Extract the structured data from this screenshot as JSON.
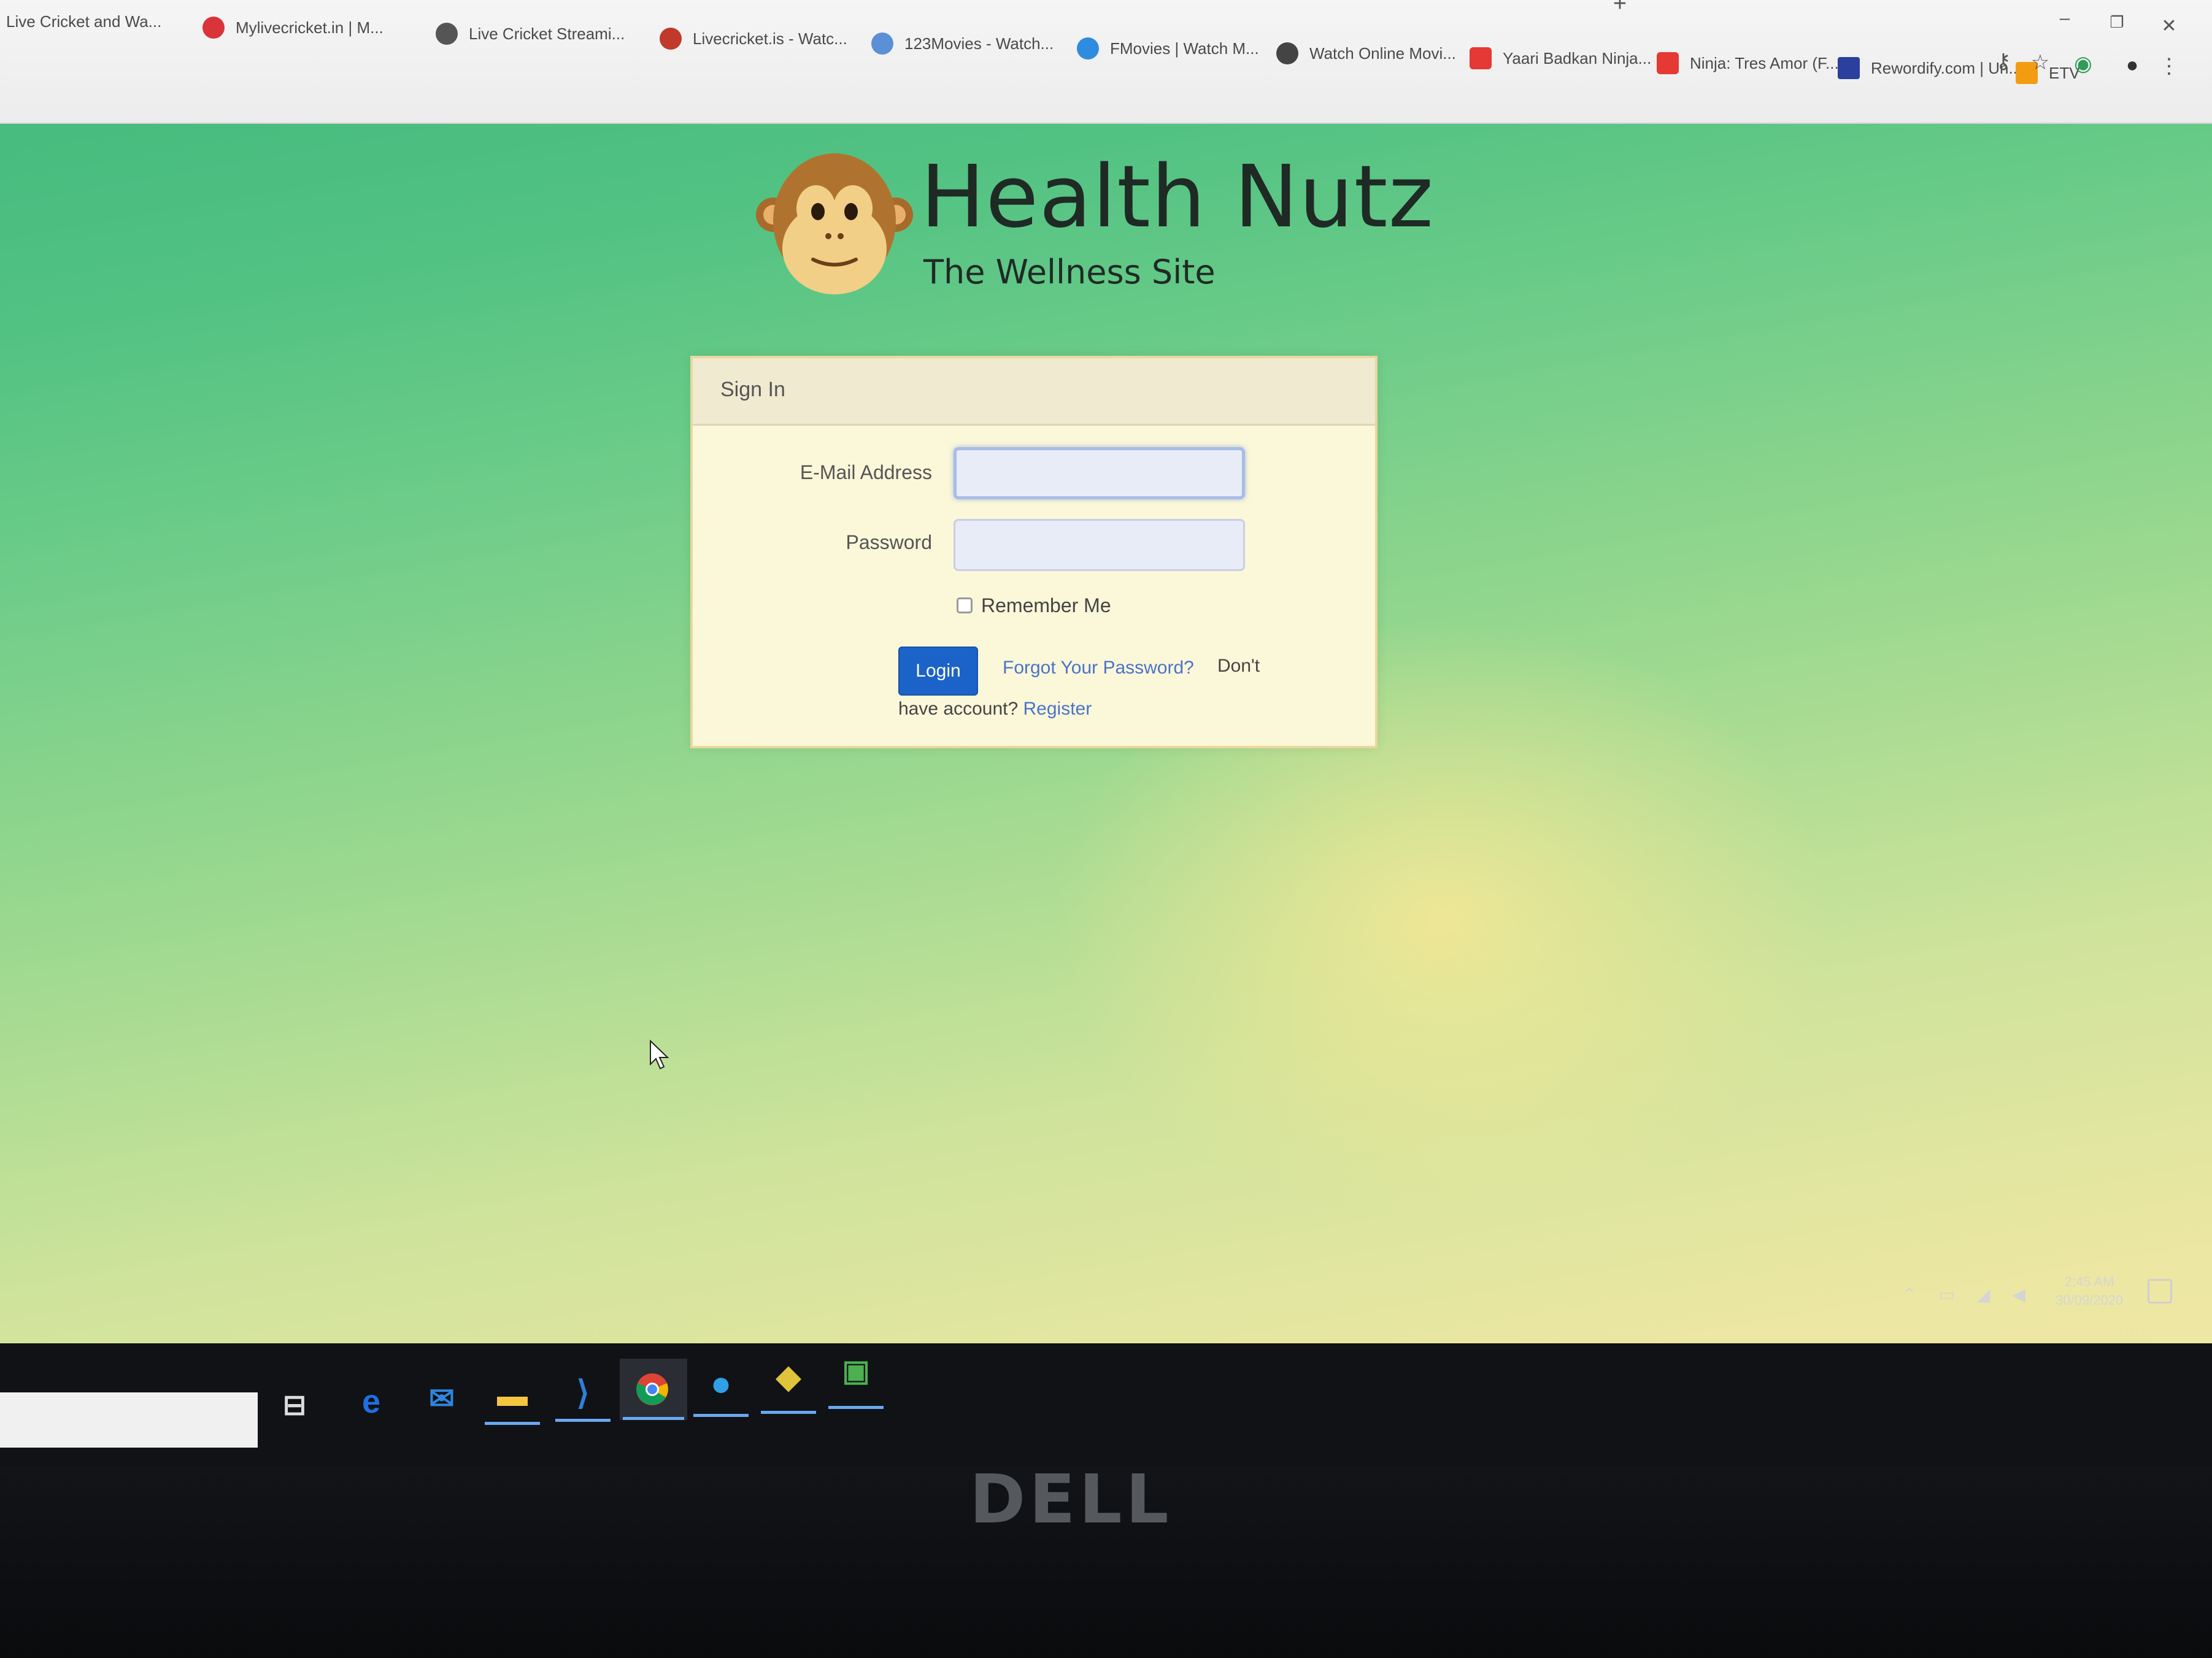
{
  "bookmarks": [
    {
      "label": "Live Cricket and Wa...",
      "color": "#8a8a8a"
    },
    {
      "label": "Mylivecricket.in | M...",
      "color": "#d9343a"
    },
    {
      "label": "Live Cricket Streami...",
      "color": "#555555"
    },
    {
      "label": "Livecricket.is - Watc...",
      "color": "#c0392b"
    },
    {
      "label": "123Movies - Watch...",
      "color": "#5b8fd6"
    },
    {
      "label": "FMovies | Watch M...",
      "color": "#2f8be0"
    },
    {
      "label": "Watch Online Movi...",
      "color": "#444444"
    },
    {
      "label": "Yaari Badkan Ninja...",
      "color": "#e53935"
    },
    {
      "label": "Ninja: Tres Amor (F...",
      "color": "#e53935"
    },
    {
      "label": "Rewordify.com | Un...",
      "color": "#2a3f9e"
    },
    {
      "label": "ETV",
      "color": "#f39c12"
    }
  ],
  "site": {
    "title": "Health Nutz",
    "subtitle": "The Wellness Site"
  },
  "signin": {
    "header": "Sign In",
    "email_label": "E-Mail Address",
    "email_value": "",
    "password_label": "Password",
    "password_value": "",
    "remember_label": "Remember Me",
    "remember_checked": false,
    "login_label": "Login",
    "forgot_label": "Forgot Your Password?",
    "dont_text": "Don't",
    "have_account_text": "have account?",
    "register_label": "Register"
  },
  "clock": {
    "time": "2:45 AM",
    "date": "30/09/2020"
  },
  "monitor": {
    "brand": "DELL"
  },
  "colors": {
    "accent": "#1b63c9",
    "link": "#4a74c9"
  }
}
